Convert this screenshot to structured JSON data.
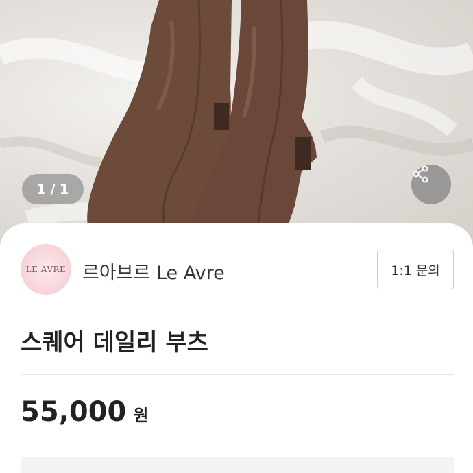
{
  "gallery": {
    "current_page": "1",
    "separator": "/",
    "total_pages": "1",
    "image_alt": "brown leather square-toe ankle boots on white fabric"
  },
  "share": {
    "icon": "share-icon"
  },
  "seller": {
    "logo_text": "LE AVRE",
    "name": "르아브르 Le Avre",
    "inquiry_button": "1:1 문의"
  },
  "product": {
    "title": "스퀘어 데일리 부츠",
    "price": "55,000",
    "currency": "원"
  },
  "colors": {
    "boot_brown": "#6b4a3a",
    "text_primary": "#222222",
    "logo_pink": "#f6d3d8"
  }
}
